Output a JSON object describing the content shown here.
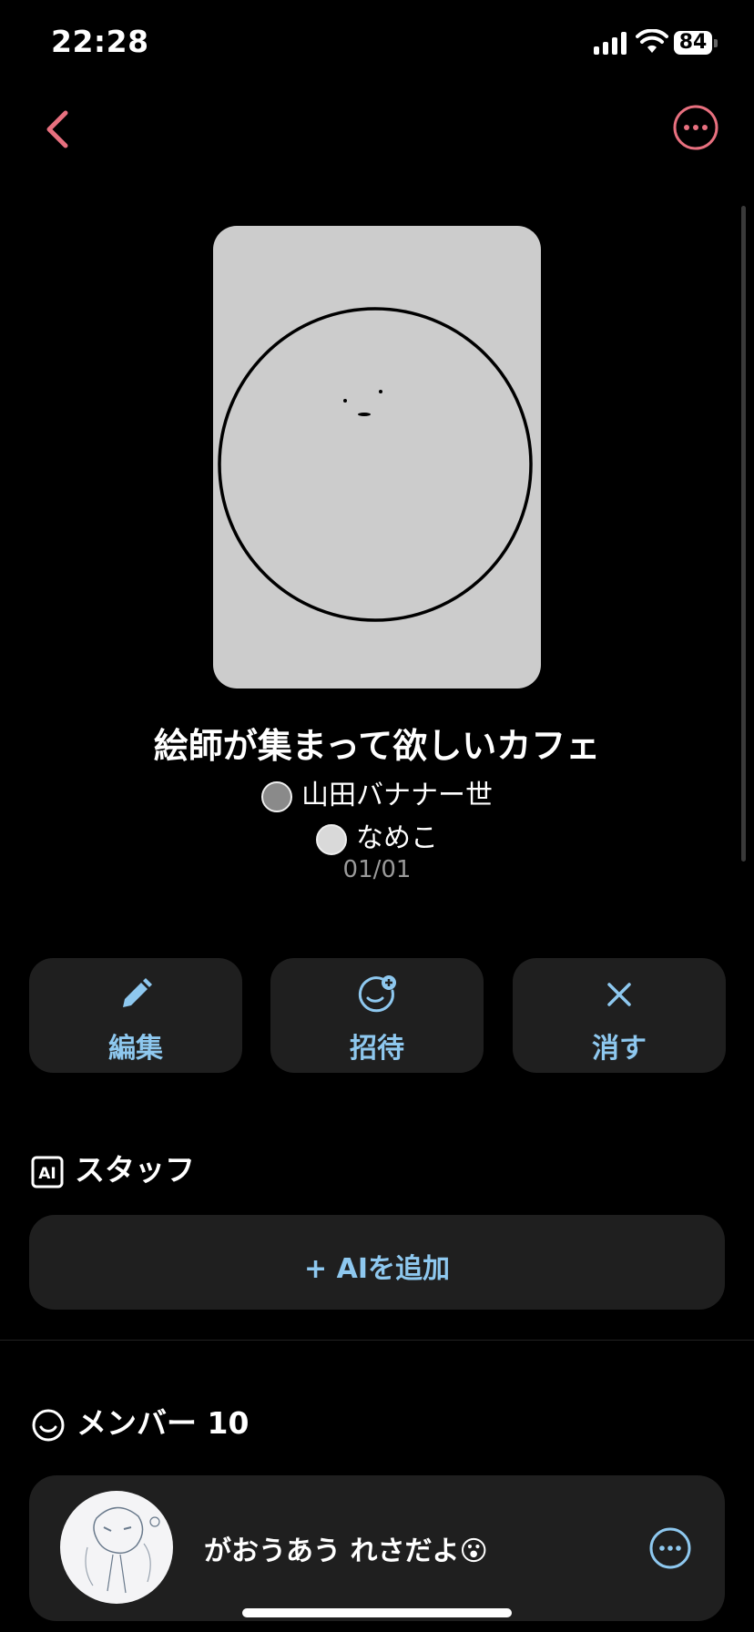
{
  "status_bar": {
    "time": "22:28",
    "battery": "84"
  },
  "room": {
    "title": "絵師が集まって欲しいカフェ",
    "owners": [
      "山田バナナー世",
      "なめこ"
    ],
    "date": "01/01"
  },
  "actions": [
    {
      "label": "編集",
      "icon": "pencil-icon"
    },
    {
      "label": "招待",
      "icon": "add-person-icon"
    },
    {
      "label": "消す",
      "icon": "close-icon"
    }
  ],
  "staff": {
    "heading": "スタッフ",
    "add_button": "+ AIを追加"
  },
  "members": {
    "heading": "メンバー 10",
    "items": [
      {
        "name": "がおうあう れさだよ😮"
      }
    ]
  },
  "colors": {
    "accent_pink": "#e8707f",
    "accent_blue": "#8ec8ef",
    "card_bg": "#1f1f1f"
  }
}
